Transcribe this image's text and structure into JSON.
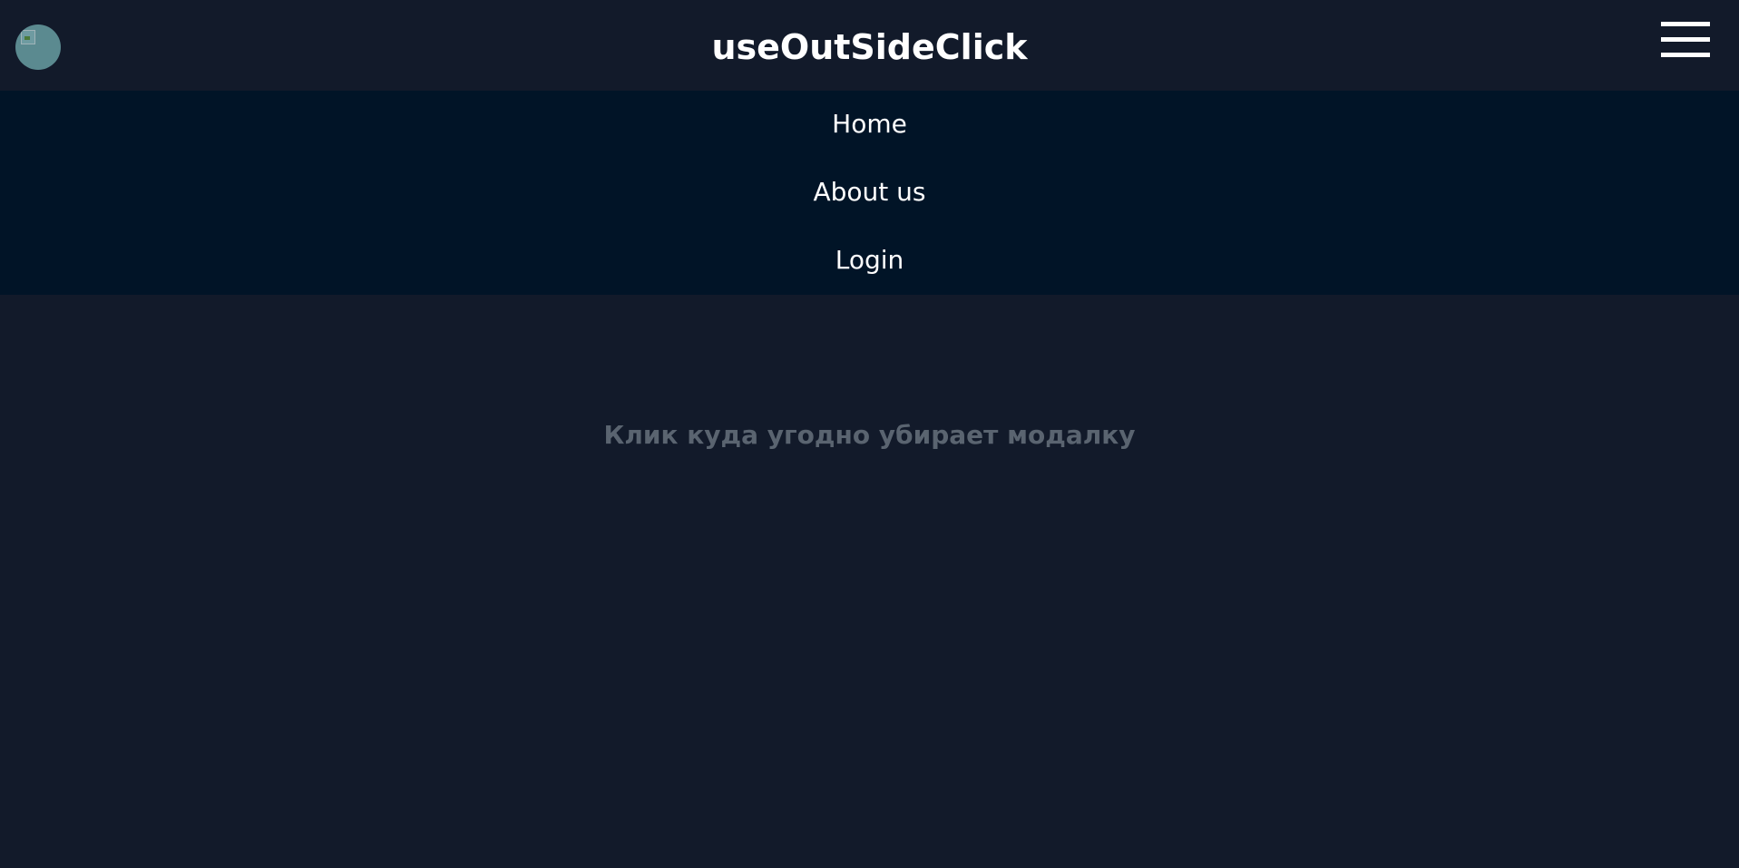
{
  "header": {
    "title": "useOutSideClick",
    "avatar_icon": "broken-image-icon",
    "menu_icon": "hamburger-icon"
  },
  "nav": {
    "items": [
      {
        "label": "Home"
      },
      {
        "label": "About us"
      },
      {
        "label": "Login"
      }
    ]
  },
  "main": {
    "hint": "Клик куда угодно убирает модалку"
  },
  "colors": {
    "background": "#121a2a",
    "nav_background": "#011427",
    "text": "#ffffff",
    "hint_text": "#5a6470",
    "avatar": "#5b8a90"
  }
}
